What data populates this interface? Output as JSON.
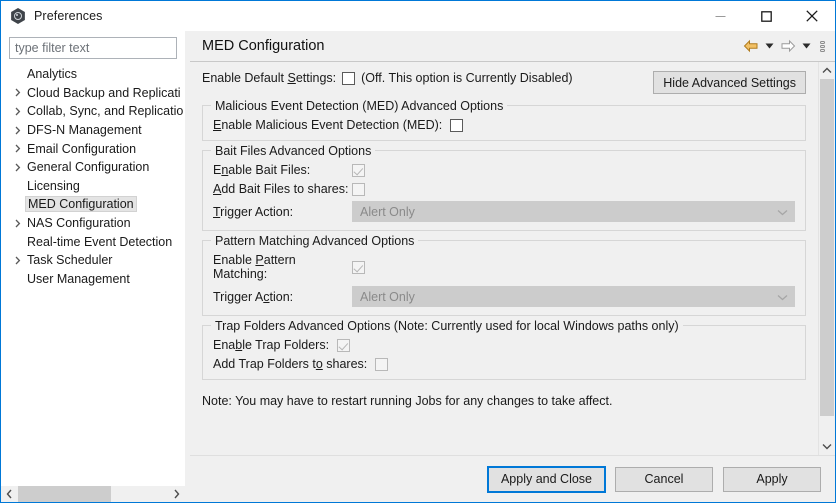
{
  "window": {
    "title": "Preferences",
    "app_icon": "preferences-gear-icon",
    "minimize_icon": "minimize-icon",
    "maximize_icon": "maximize-icon",
    "close_icon": "close-icon"
  },
  "sidebar": {
    "filter_placeholder": "type filter text",
    "filter_value": "",
    "scroll_left_icon": "chevron-left-icon",
    "scroll_right_icon": "chevron-right-icon",
    "items": [
      {
        "label": "Analytics",
        "expandable": false,
        "selected": false
      },
      {
        "label": "Cloud Backup and Replicati",
        "expandable": true,
        "selected": false
      },
      {
        "label": "Collab, Sync, and Replicatio",
        "expandable": true,
        "selected": false
      },
      {
        "label": "DFS-N Management",
        "expandable": true,
        "selected": false
      },
      {
        "label": "Email Configuration",
        "expandable": true,
        "selected": false
      },
      {
        "label": "General Configuration",
        "expandable": true,
        "selected": false
      },
      {
        "label": "Licensing",
        "expandable": false,
        "selected": false
      },
      {
        "label": "MED Configuration",
        "expandable": false,
        "selected": true
      },
      {
        "label": "NAS Configuration",
        "expandable": true,
        "selected": false
      },
      {
        "label": "Real-time Event Detection",
        "expandable": false,
        "selected": false
      },
      {
        "label": "Task Scheduler",
        "expandable": true,
        "selected": false
      },
      {
        "label": "User Management",
        "expandable": false,
        "selected": false
      }
    ]
  },
  "page": {
    "title": "MED Configuration",
    "tools": {
      "back_icon": "back-arrow-icon",
      "back_caret_icon": "caret-down-icon",
      "forward_icon": "forward-arrow-icon",
      "forward_caret_icon": "caret-down-icon",
      "menu_icon": "view-menu-icon"
    },
    "default_settings": {
      "label_pre": "Enable ",
      "label_mnemonic": "S",
      "label_post": "ettings: ",
      "label_prefix_word": "Default ",
      "full_label": "Enable Default Settings:",
      "checked": false,
      "disabled": false,
      "hint": "(Off. This option is Currently Disabled)"
    },
    "hide_advanced_button": "Hide Advanced Settings",
    "groups": [
      {
        "legend": "Malicious Event Detection (MED) Advanced Options",
        "rows": [
          {
            "type": "checkbox",
            "label_pre": "",
            "label_mnemonic": "E",
            "label_post": "nable Malicious Event Detection (MED):",
            "checked": false,
            "disabled": false
          }
        ]
      },
      {
        "legend": "Bait Files Advanced Options",
        "rows": [
          {
            "type": "checkbox",
            "label_pre": "E",
            "label_mnemonic": "n",
            "label_post": "able Bait Files:",
            "checked": true,
            "disabled": true
          },
          {
            "type": "checkbox",
            "label_pre": "",
            "label_mnemonic": "A",
            "label_post": "dd Bait Files to shares:",
            "checked": false,
            "disabled": true
          },
          {
            "type": "combo",
            "label_pre": "",
            "label_mnemonic": "T",
            "label_post": "rigger Action:",
            "value": "Alert Only",
            "disabled": true,
            "chevron_icon": "chevron-down-icon"
          }
        ]
      },
      {
        "legend": "Pattern Matching Advanced Options",
        "rows": [
          {
            "type": "checkbox",
            "label_pre": "Enable ",
            "label_mnemonic": "P",
            "label_post": "attern Matching:",
            "checked": true,
            "disabled": true
          },
          {
            "type": "combo",
            "label_pre": "Trigger A",
            "label_mnemonic": "c",
            "label_post": "tion:",
            "value": "Alert Only",
            "disabled": true,
            "chevron_icon": "chevron-down-icon"
          }
        ]
      },
      {
        "legend": "Trap Folders Advanced Options (Note: Currently used for local Windows paths only)",
        "rows": [
          {
            "type": "checkbox",
            "label_pre": "Ena",
            "label_mnemonic": "b",
            "label_post": "le Trap Folders:",
            "checked": true,
            "disabled": true
          },
          {
            "type": "checkbox",
            "label_pre": "Add Trap Folders t",
            "label_mnemonic": "o",
            "label_post": " shares:",
            "checked": false,
            "disabled": true
          }
        ]
      }
    ],
    "note": "Note: You may have to restart running Jobs for any changes to take affect.",
    "scroll_up_icon": "chevron-up-icon",
    "scroll_down_icon": "chevron-down-icon"
  },
  "footer": {
    "apply_and_close": "Apply and Close",
    "cancel": "Cancel",
    "apply": "Apply"
  },
  "colors": {
    "window_border": "#0078d7",
    "focus_ring": "#0078d7",
    "panel_bg": "#f0f0f0",
    "selection_bg": "#e4e4e4",
    "back_arrow": "#e8a33d"
  }
}
